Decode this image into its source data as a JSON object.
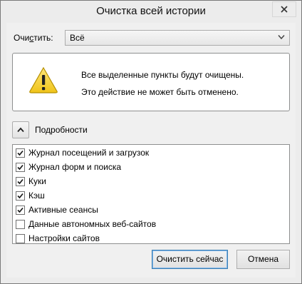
{
  "window": {
    "title": "Очистка всей истории"
  },
  "clear": {
    "label_before": "Очи",
    "label_underlined": "с",
    "label_after": "тить:",
    "selected": "Всё"
  },
  "warning": {
    "line1": "Все выделенные пункты будут очищены.",
    "line2": "Это действие не может быть отменено."
  },
  "details": {
    "label": "Подробности"
  },
  "items": [
    {
      "label": "Журнал посещений и загрузок",
      "checked": true
    },
    {
      "label": "Журнал форм и поиска",
      "checked": true
    },
    {
      "label": "Куки",
      "checked": true
    },
    {
      "label": "Кэш",
      "checked": true
    },
    {
      "label": "Активные сеансы",
      "checked": true
    },
    {
      "label": "Данные автономных веб-сайтов",
      "checked": false
    },
    {
      "label": "Настройки сайтов",
      "checked": false
    }
  ],
  "buttons": {
    "clear_now": "Очистить сейчас",
    "cancel": "Отмена"
  },
  "colors": {
    "warning_yellow": "#f5cf2b",
    "warning_border": "#b58f00",
    "check": "#1a1a1a"
  },
  "icons": {
    "close": "close-icon",
    "warning": "warning-icon",
    "chevron": "chevron-up-icon",
    "dropdown": "chevron-down-icon"
  }
}
